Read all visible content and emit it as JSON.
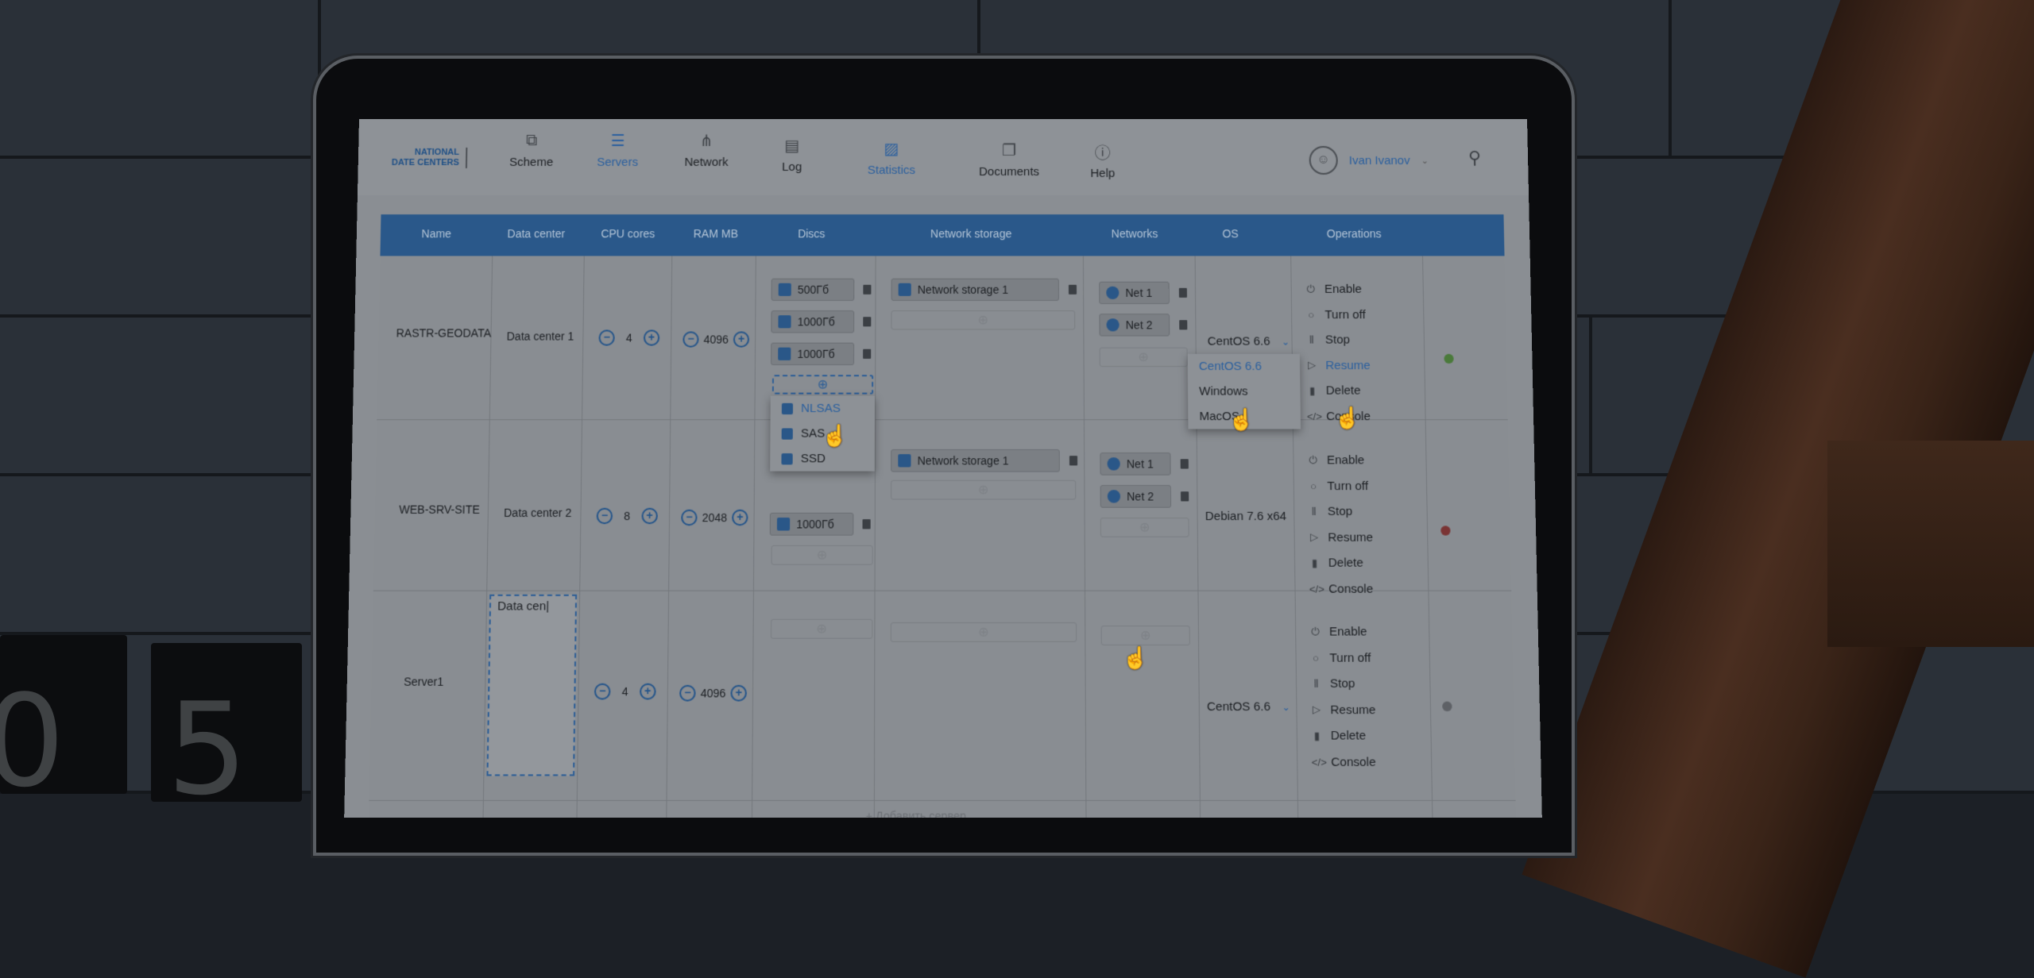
{
  "header": {
    "logo_line1": "NATIONAL",
    "logo_line2": "DATE CENTERS",
    "nav": [
      {
        "label": "Scheme",
        "icon": "scheme-icon"
      },
      {
        "label": "Servers",
        "icon": "servers-icon",
        "active": true
      },
      {
        "label": "Network",
        "icon": "network-icon"
      },
      {
        "label": "Log",
        "icon": "log-icon"
      },
      {
        "label": "Statistics",
        "icon": "statistics-icon",
        "active": true
      },
      {
        "label": "Documents",
        "icon": "documents-icon"
      },
      {
        "label": "Help",
        "icon": "help-icon"
      }
    ],
    "user_name": "Ivan Ivanov"
  },
  "table": {
    "columns": [
      "Name",
      "Data center",
      "CPU cores",
      "RAM MB",
      "Discs",
      "Network storage",
      "Networks",
      "OS",
      "Operations"
    ],
    "rows": [
      {
        "name": "RASTR-GEODATA",
        "data_center": "Data center 1",
        "cpu": "4",
        "ram": "4096",
        "discs": [
          "500Гб",
          "1000Гб",
          "1000Гб"
        ],
        "storage": [
          "Network storage 1"
        ],
        "networks": [
          "Net 1",
          "Net 2"
        ],
        "os": "CentOS 6.6",
        "status_color": "#4a7a3a"
      },
      {
        "name": "WEB-SRV-SITE",
        "data_center": "Data center 2",
        "cpu": "8",
        "ram": "2048",
        "discs": [
          "1000Гб"
        ],
        "storage": [
          "Network storage 1"
        ],
        "networks": [
          "Net 1",
          "Net 2"
        ],
        "os": "Debian 7.6 x64",
        "status_color": "#7a3434"
      },
      {
        "name": "Server1",
        "data_center_input": "Data cen|",
        "cpu": "4",
        "ram": "4096",
        "os": "CentOS 6.6",
        "status_color": "#5e6166"
      }
    ],
    "operations": [
      "Enable",
      "Turn off",
      "Stop",
      "Resume",
      "Delete",
      "Console"
    ],
    "disc_type_menu": [
      "NLSAS",
      "SAS",
      "SSD"
    ],
    "os_menu": [
      "CentOS 6.6",
      "Windows",
      "MacOS"
    ],
    "footer_add": "+ Добавить сервер"
  }
}
